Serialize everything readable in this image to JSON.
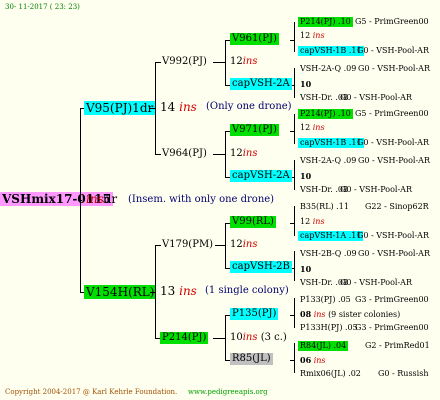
{
  "header": {
    "date": "30- 11-2017 ( 23: 23)"
  },
  "root": {
    "name": "VSHmix17-0115",
    "ins": "ins",
    "suffix": "dr",
    "note": "(Insem. with only one drone)"
  },
  "level1": [
    {
      "name": "V95(PJ)1dr",
      "num": "14",
      "ins": "ins",
      "note": "(Only one drone)"
    },
    {
      "name": "V154H(RL)",
      "num": "13",
      "ins": "ins",
      "note": "(1 single colony)"
    }
  ],
  "level2": [
    {
      "name": "V992(PJ)",
      "num": "12",
      "ins": "ins"
    },
    {
      "name": "V964(PJ)",
      "num": "12",
      "ins": "ins"
    },
    {
      "name": "V179(PM)",
      "num": "12",
      "ins": "ins"
    },
    {
      "name": "P214(PJ)",
      "num": "10",
      "ins": "ins",
      "note": "(3 c.)"
    }
  ],
  "level3": [
    {
      "name": "V961(PJ)"
    },
    {
      "name": "capVSH-2A"
    },
    {
      "name": "V971(PJ)"
    },
    {
      "name": "capVSH-2A"
    },
    {
      "name": "V99(RL)"
    },
    {
      "name": "capVSH-2B"
    },
    {
      "name": "P135(PJ)"
    },
    {
      "name": "R85(JL)"
    }
  ],
  "level4": [
    {
      "line1": "P214(PJ) .10",
      "line1b": "G5 - PrimGreen00",
      "num": "12",
      "ins": "ins",
      "line3": "capVSH-1B .11",
      "line3b": "G0 - VSH-Pool-AR"
    },
    {
      "line1": "VSH-2A-Q .09",
      "line1b": "G0 - VSH-Pool-AR",
      "num": "10",
      "ins": "",
      "line3": "VSH-Dr. .08",
      "line3b": "G0 - VSH-Pool-AR"
    },
    {
      "line1": "P214(PJ) .10",
      "line1b": "G5 - PrimGreen00",
      "num": "12",
      "ins": "ins",
      "line3": "capVSH-1B .11",
      "line3b": "G0 - VSH-Pool-AR"
    },
    {
      "line1": "VSH-2A-Q .09",
      "line1b": "G0 - VSH-Pool-AR",
      "num": "10",
      "ins": "",
      "line3": "VSH-Dr. .08",
      "line3b": "G0 - VSH-Pool-AR"
    },
    {
      "line1": "B35(RL) .11",
      "line1b": "G22 - Sinop62R",
      "num": "12",
      "ins": "ins",
      "line3": "capVSH-1A .11",
      "line3b": "G0 - VSH-Pool-AR"
    },
    {
      "line1": "VSH-2B-Q .09",
      "line1b": "G0 - VSH-Pool-AR",
      "num": "10",
      "ins": "",
      "line3": "VSH-Dr. .08",
      "line3b": "G0 - VSH-Pool-AR"
    },
    {
      "line1": "P133(PJ) .05",
      "line1b": "G3 - PrimGreen00",
      "num": "08",
      "ins": "ins",
      "note": "(9 sister colonies)",
      "line3": "P133H(PJ) .05",
      "line3b": "G3 - PrimGreen00"
    },
    {
      "line1": "R84(JL) .04",
      "line1b": "G2 - PrimRed01",
      "num": "06",
      "ins": "ins",
      "line3": "Rmix06(JL) .02",
      "line3b": "G0 - Russish"
    }
  ],
  "footer": {
    "copyright": "Copyright 2004-2017 @ Karl Kehrle Foundation.",
    "url": "www.pedigreeapis.org"
  }
}
